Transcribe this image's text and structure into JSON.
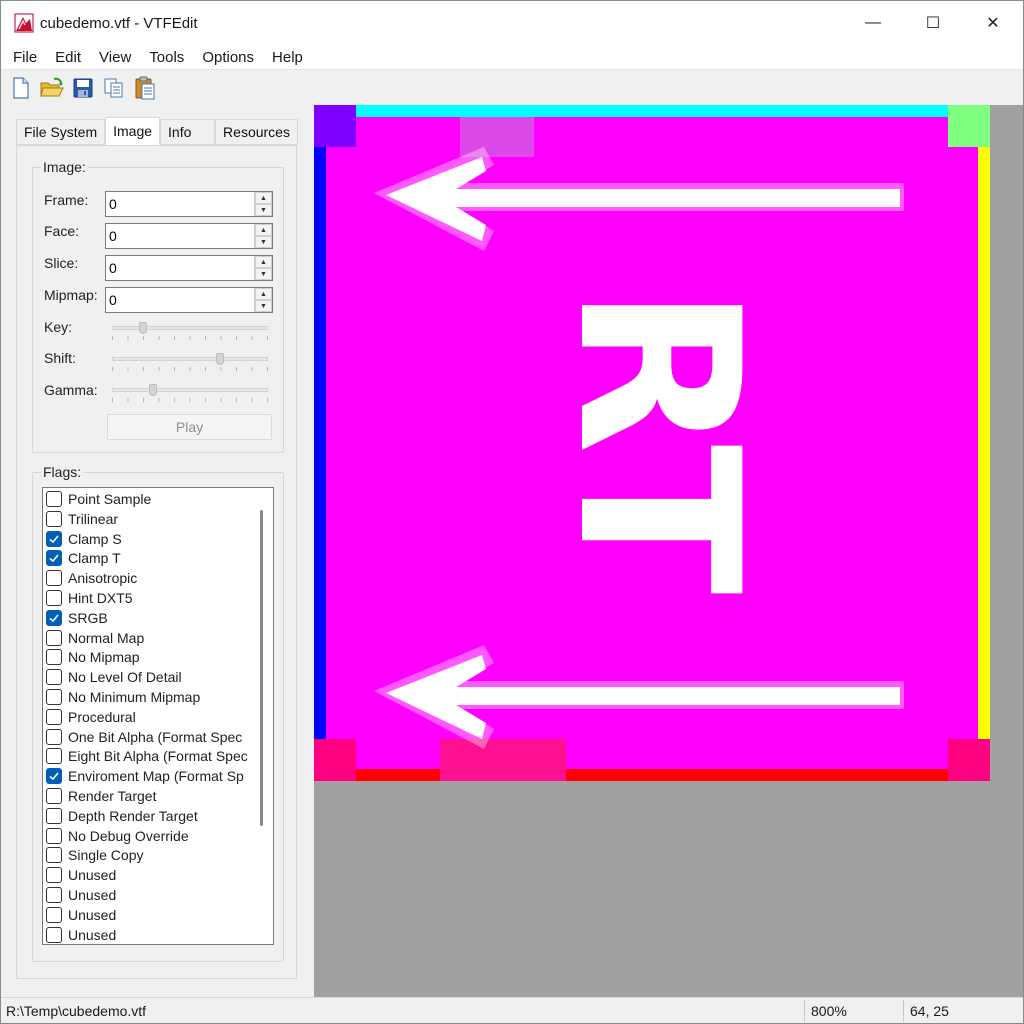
{
  "window": {
    "title": "cubedemo.vtf - VTFEdit",
    "controls": {
      "minimize": "—",
      "maximize": "☐",
      "close": "✕"
    }
  },
  "menu": [
    "File",
    "Edit",
    "View",
    "Tools",
    "Options",
    "Help"
  ],
  "toolbar": [
    "new-icon",
    "open-icon",
    "save-icon",
    "copy-icon",
    "paste-icon"
  ],
  "tabs": [
    "File System",
    "Image",
    "Info",
    "Resources"
  ],
  "active_tab": "Image",
  "image_group": {
    "title": "Image:",
    "fields": [
      {
        "label": "Frame:",
        "value": "0"
      },
      {
        "label": "Face:",
        "value": "0"
      },
      {
        "label": "Slice:",
        "value": "0"
      },
      {
        "label": "Mipmap:",
        "value": "0"
      }
    ],
    "sliders": [
      {
        "label": "Key:",
        "level": 0.18
      },
      {
        "label": "Shift:",
        "level": 0.7
      },
      {
        "label": "Gamma:",
        "level": 0.25
      }
    ],
    "play_label": "Play"
  },
  "flags_group": {
    "title": "Flags:",
    "items": [
      {
        "label": "Point Sample",
        "checked": false
      },
      {
        "label": "Trilinear",
        "checked": false
      },
      {
        "label": "Clamp S",
        "checked": true
      },
      {
        "label": "Clamp T",
        "checked": true
      },
      {
        "label": "Anisotropic",
        "checked": false
      },
      {
        "label": "Hint DXT5",
        "checked": false
      },
      {
        "label": "SRGB",
        "checked": true
      },
      {
        "label": "Normal Map",
        "checked": false
      },
      {
        "label": "No Mipmap",
        "checked": false
      },
      {
        "label": "No Level Of Detail",
        "checked": false
      },
      {
        "label": "No Minimum Mipmap",
        "checked": false
      },
      {
        "label": "Procedural",
        "checked": false
      },
      {
        "label": "One Bit Alpha (Format Spec",
        "checked": false
      },
      {
        "label": "Eight Bit Alpha (Format Spec",
        "checked": false
      },
      {
        "label": "Enviroment Map (Format Sp",
        "checked": true
      },
      {
        "label": "Render Target",
        "checked": false
      },
      {
        "label": "Depth Render Target",
        "checked": false
      },
      {
        "label": "No Debug Override",
        "checked": false
      },
      {
        "label": "Single Copy",
        "checked": false
      },
      {
        "label": "Unused",
        "checked": false
      },
      {
        "label": "Unused",
        "checked": false
      },
      {
        "label": "Unused",
        "checked": false
      },
      {
        "label": "Unused",
        "checked": false
      }
    ]
  },
  "texture": {
    "face_label": "RT",
    "colors": {
      "background": "#ff00ff",
      "top_edge": "#00ffff",
      "right_edge": "#ffff00",
      "bottom_edge": "#ff0000",
      "left_edge": "#0000ff",
      "glyph": "#ffffff"
    }
  },
  "status": {
    "path": "R:\\Temp\\cubedemo.vtf",
    "zoom": "800%",
    "coords": "64, 25"
  }
}
